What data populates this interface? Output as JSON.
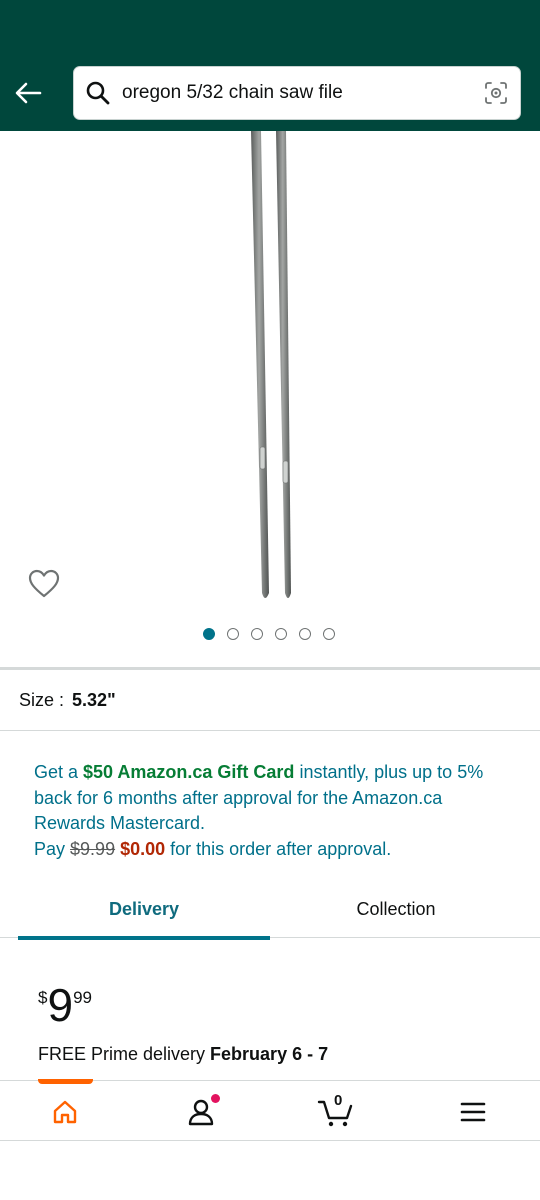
{
  "header": {
    "search_query": "oregon 5/32 chain saw file"
  },
  "gallery": {
    "image_count": 6,
    "active_index": 0
  },
  "variant": {
    "size_label": "Size :",
    "size_value": "5.32\""
  },
  "promo": {
    "part1": "Get a ",
    "highlight": "$50 Amazon.ca Gift Card",
    "part2": " instantly, plus up to 5% back for 6 months after approval for the Amazon.ca Rewards Mastercard.",
    "pay_label": "Pay ",
    "old_price": "$9.99",
    "new_price": "$0.00",
    "pay_suffix": " for this order after approval."
  },
  "tabs": {
    "delivery": "Delivery",
    "collection": "Collection"
  },
  "price": {
    "symbol": "$",
    "whole": "9",
    "fraction": "99"
  },
  "delivery": {
    "prefix": "FREE Prime delivery ",
    "dates": "February 6 - 7"
  },
  "bottom_nav": {
    "cart_count": "0"
  },
  "colors": {
    "header_bg": "#00473c",
    "accent": "#00738a",
    "promo_green": "#067d35",
    "price_red": "#b12704",
    "nav_active": "#ff6200"
  }
}
